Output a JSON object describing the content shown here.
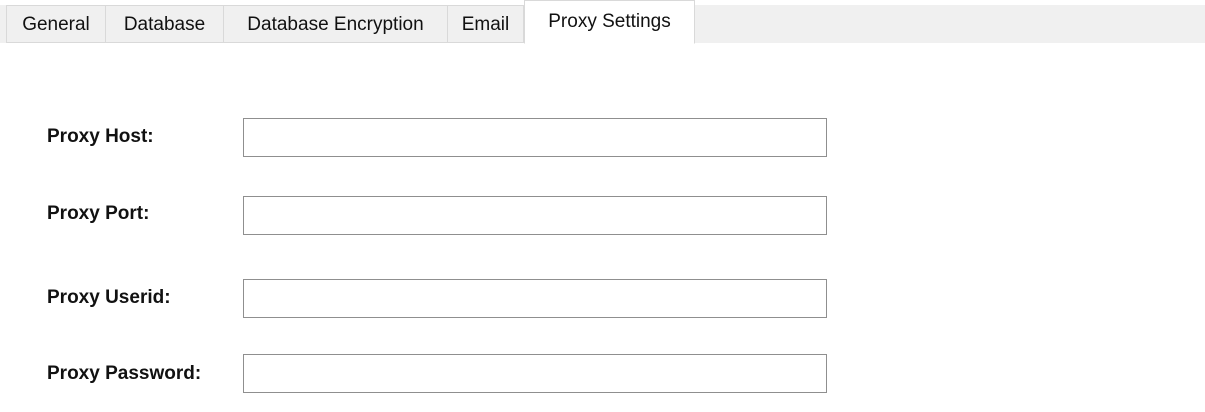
{
  "tabs": [
    {
      "label": "General",
      "active": false
    },
    {
      "label": "Database",
      "active": false
    },
    {
      "label": "Database Encryption",
      "active": false
    },
    {
      "label": "Email",
      "active": false
    },
    {
      "label": "Proxy Settings",
      "active": true
    }
  ],
  "form": {
    "host": {
      "label": "Proxy Host:",
      "value": ""
    },
    "port": {
      "label": "Proxy Port:",
      "value": ""
    },
    "userid": {
      "label": "Proxy Userid:",
      "value": ""
    },
    "password": {
      "label": "Proxy Password:",
      "value": ""
    }
  }
}
